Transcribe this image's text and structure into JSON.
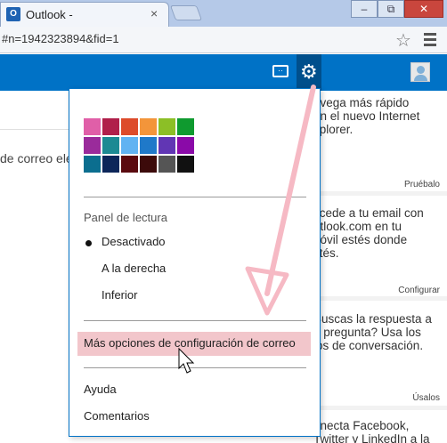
{
  "browser": {
    "tab_title": "Outlook -",
    "tab_favicon": "O",
    "tab_close": "×",
    "url": "#n=1942323894&fid=1",
    "window_buttons": [
      "‒",
      "⧉",
      "✕"
    ]
  },
  "header": {
    "chat_icon_glyph": "··",
    "gear_icon_glyph": "⚙"
  },
  "main": {
    "partial_text": "de correo ele"
  },
  "settings_menu": {
    "theme_colors": [
      [
        "#e05fa8",
        "#b01f4a",
        "#dd4b2a",
        "#f3953a",
        "#8cbf26",
        "#0f9a2f"
      ],
      [
        "#9a2b9b",
        "#1c8a93",
        "#61b3f2",
        "#1f79c9",
        "#6136b4",
        "#8a0aa8"
      ],
      [
        "#0b6e8f",
        "#0c2659",
        "#5a0a0f",
        "#3c0a0a",
        "#555555",
        "#111111"
      ]
    ],
    "reading_pane_heading": "Panel de lectura",
    "reading_pane_options": [
      "Desactivado",
      "A la derecha",
      "Inferior"
    ],
    "selected_option": "Desactivado",
    "more_options_label": "Más opciones de configuración de correo",
    "help_label": "Ayuda",
    "feedback_label": "Comentarios"
  },
  "ads": [
    {
      "text": "avega más rápido\non el nuevo Internet\nxplorer.",
      "link": "Pruébalo"
    },
    {
      "text": "ccede a tu email con\nutlook.com en tu\nnóvil estés donde\nstés.",
      "link": "Configurar"
    },
    {
      "text": "Buscas la respuesta a\nu pregunta? Usa los\nlos de conversación.",
      "link": "Úsalos"
    },
    {
      "text": "onecta Facebook,\nTwitter y LinkedIn a la",
      "link": ""
    }
  ],
  "colors": {
    "brand_blue": "#0072c6",
    "highlight_pink": "#f2c6cb",
    "arrow_pink": "#f6b9c4"
  }
}
